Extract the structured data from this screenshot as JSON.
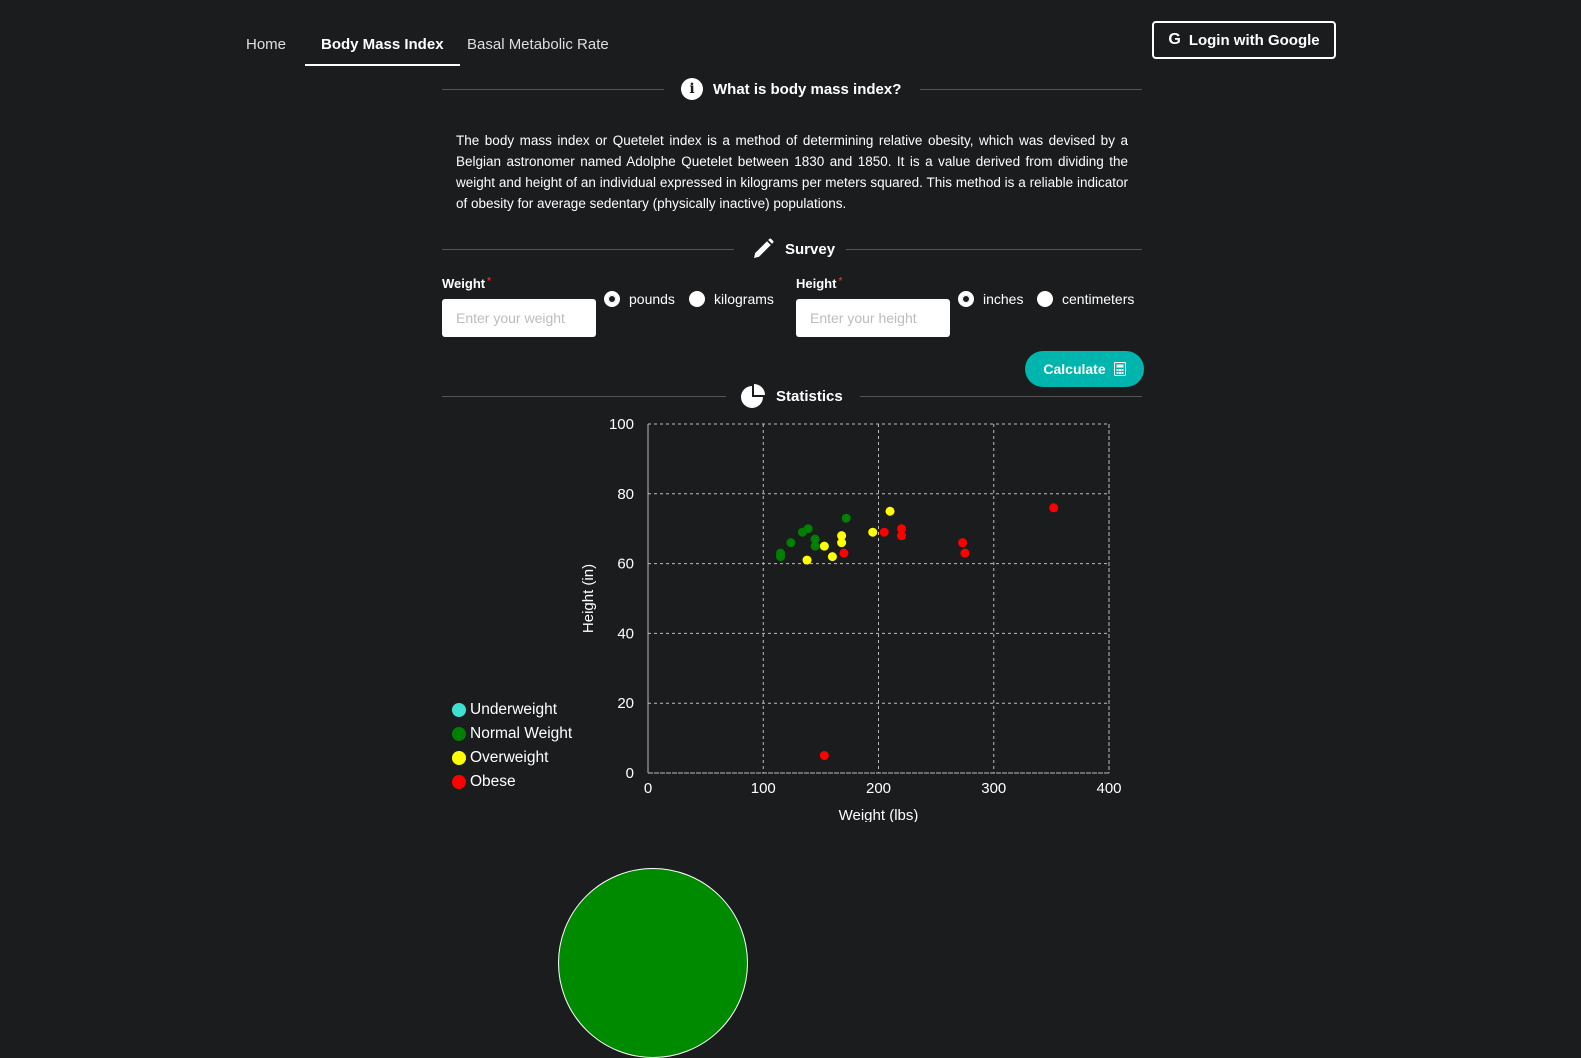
{
  "nav": {
    "items": [
      {
        "label": "Home",
        "active": false
      },
      {
        "label": "Body Mass Index",
        "active": true
      },
      {
        "label": "Basal Metabolic Rate",
        "active": false
      }
    ],
    "login_label": "Login with Google",
    "login_icon": "google-g-icon"
  },
  "about": {
    "heading": "What is body mass index?",
    "icon": "info-circle-icon",
    "text": "The body mass index or Quetelet index is a method of determining relative obesity, which was devised by a Belgian astronomer named Adolphe Quetelet between 1830 and 1850. It is a value derived from dividing the weight and height of an individual expressed in kilograms per meters squared. This method is a reliable indicator of obesity for average sedentary (physically inactive) populations."
  },
  "survey": {
    "heading": "Survey",
    "icon": "pencil-icon",
    "weight": {
      "label": "Weight",
      "placeholder": "Enter your weight",
      "units": [
        {
          "label": "pounds",
          "checked": true
        },
        {
          "label": "kilograms",
          "checked": false
        }
      ]
    },
    "height": {
      "label": "Height",
      "placeholder": "Enter your height",
      "units": [
        {
          "label": "inches",
          "checked": true
        },
        {
          "label": "centimeters",
          "checked": false
        }
      ]
    },
    "required_mark": "*",
    "calculate_label": "Calculate",
    "calculate_icon": "calculator-icon"
  },
  "statistics": {
    "heading": "Statistics",
    "icon": "pie-chart-icon"
  },
  "colors": {
    "background": "#1b1c1d",
    "teal": "#00b5ad",
    "underweight": "#40e0d0",
    "normal": "#008000",
    "overweight": "#ffff00",
    "obese": "#ff0000"
  },
  "chart_data": {
    "type": "scatter",
    "xlabel": "Weight (lbs)",
    "ylabel": "Height (in)",
    "xlim": [
      0,
      400
    ],
    "ylim": [
      0,
      100
    ],
    "xticks": [
      0,
      100,
      200,
      300,
      400
    ],
    "yticks": [
      0,
      20,
      40,
      60,
      80,
      100
    ],
    "grid": true,
    "legend_position": "bottom-left",
    "series": [
      {
        "name": "Underweight",
        "color": "#40e0d0",
        "points": []
      },
      {
        "name": "Normal Weight",
        "color": "#008000",
        "points": [
          [
            115,
            62
          ],
          [
            115,
            63
          ],
          [
            124,
            66
          ],
          [
            134,
            69
          ],
          [
            139,
            70
          ],
          [
            145,
            67
          ],
          [
            145,
            65
          ],
          [
            172,
            73
          ]
        ]
      },
      {
        "name": "Overweight",
        "color": "#ffff00",
        "points": [
          [
            138,
            61
          ],
          [
            153,
            65
          ],
          [
            160,
            62
          ],
          [
            168,
            68
          ],
          [
            168,
            66
          ],
          [
            195,
            69
          ],
          [
            210,
            75
          ]
        ]
      },
      {
        "name": "Obese",
        "color": "#ff0000",
        "points": [
          [
            153,
            5
          ],
          [
            170,
            63
          ],
          [
            205,
            69
          ],
          [
            220,
            70
          ],
          [
            220,
            68
          ],
          [
            273,
            66
          ],
          [
            275,
            63
          ],
          [
            352,
            76
          ]
        ]
      }
    ]
  }
}
